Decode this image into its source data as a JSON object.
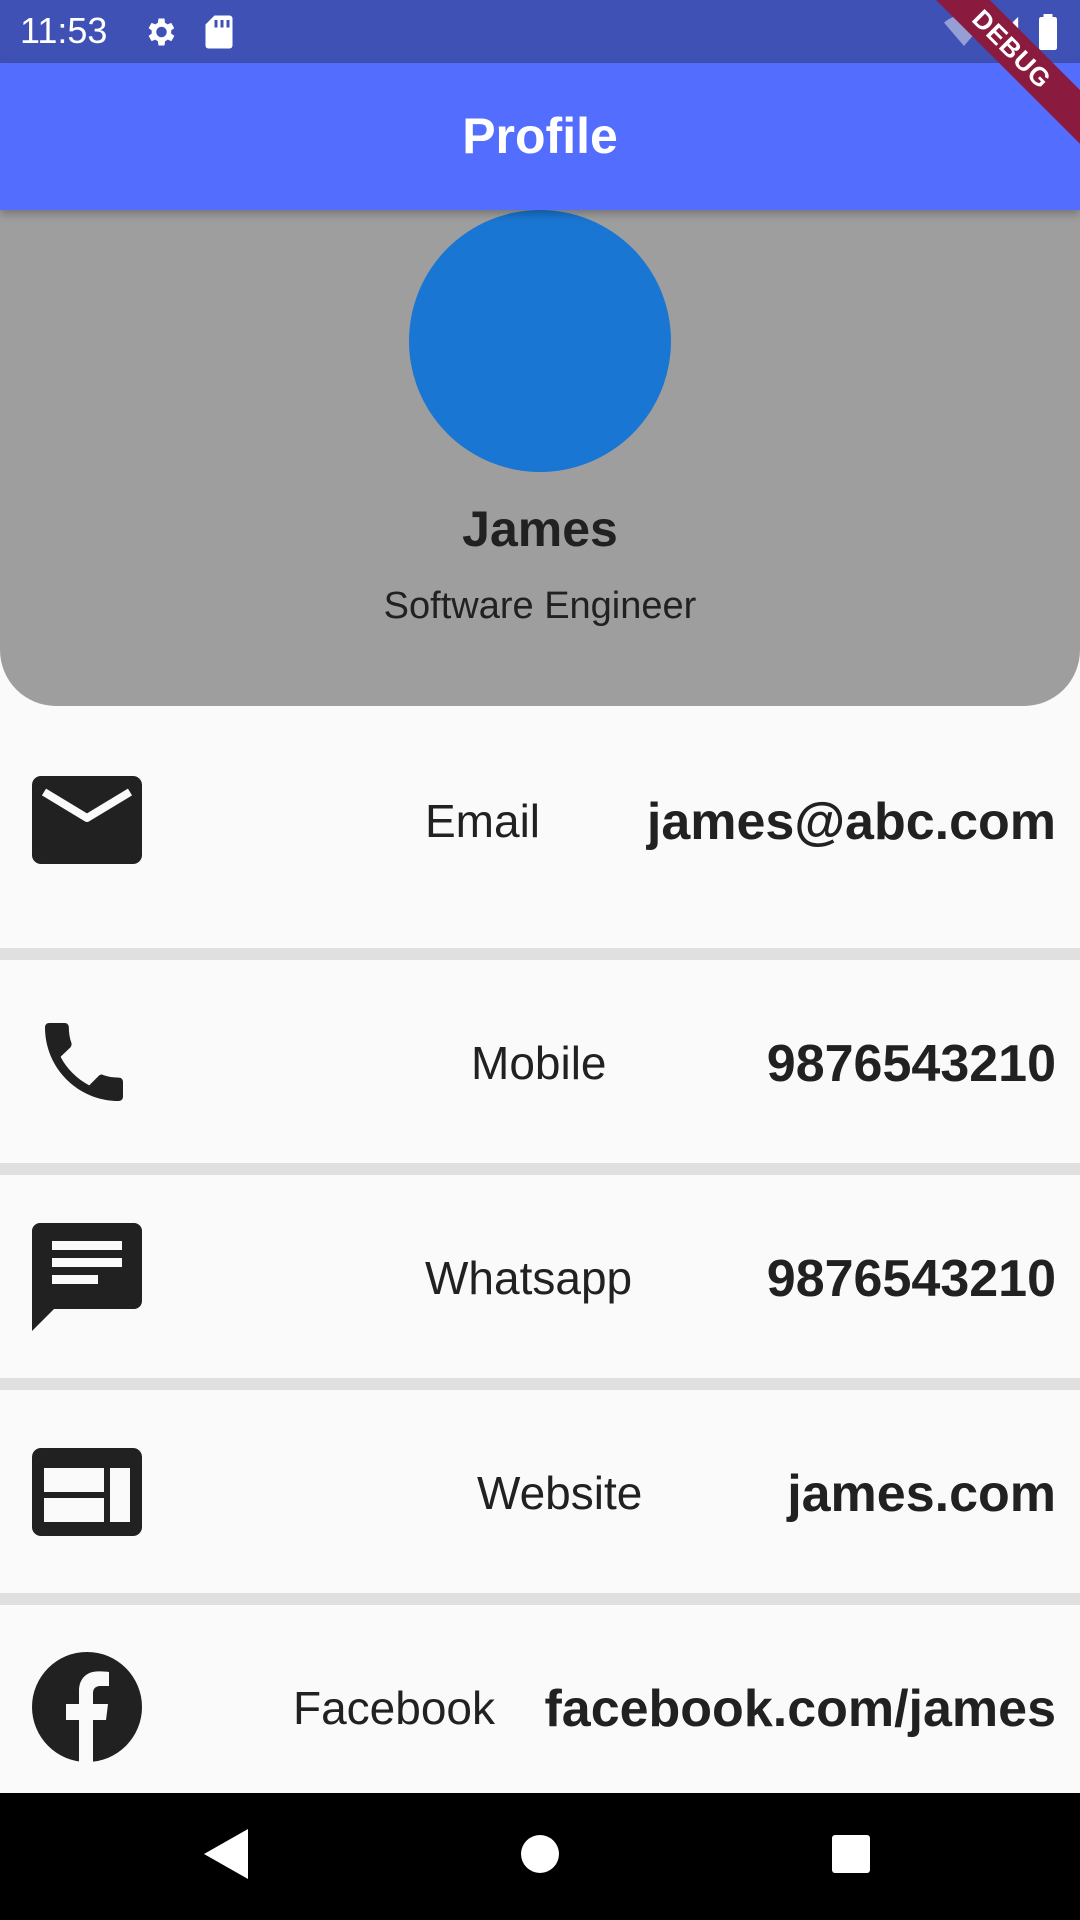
{
  "status_bar": {
    "time": "11:53"
  },
  "app_bar": {
    "title": "Profile",
    "debug_banner": "DEBUG"
  },
  "profile": {
    "name": "James",
    "title": "Software Engineer",
    "avatar_color": "#1976d2"
  },
  "contacts": [
    {
      "label": "Email",
      "value": "james@abc.com",
      "icon": "email-icon"
    },
    {
      "label": "Mobile",
      "value": "9876543210",
      "icon": "phone-icon"
    },
    {
      "label": "Whatsapp",
      "value": "9876543210",
      "icon": "message-icon"
    },
    {
      "label": "Website",
      "value": "james.com",
      "icon": "web-icon"
    },
    {
      "label": "Facebook",
      "value": "facebook.com/james",
      "icon": "facebook-icon"
    }
  ],
  "colors": {
    "status_bar": "#3f51b5",
    "app_bar": "#536dfe",
    "header": "#9e9e9e"
  }
}
